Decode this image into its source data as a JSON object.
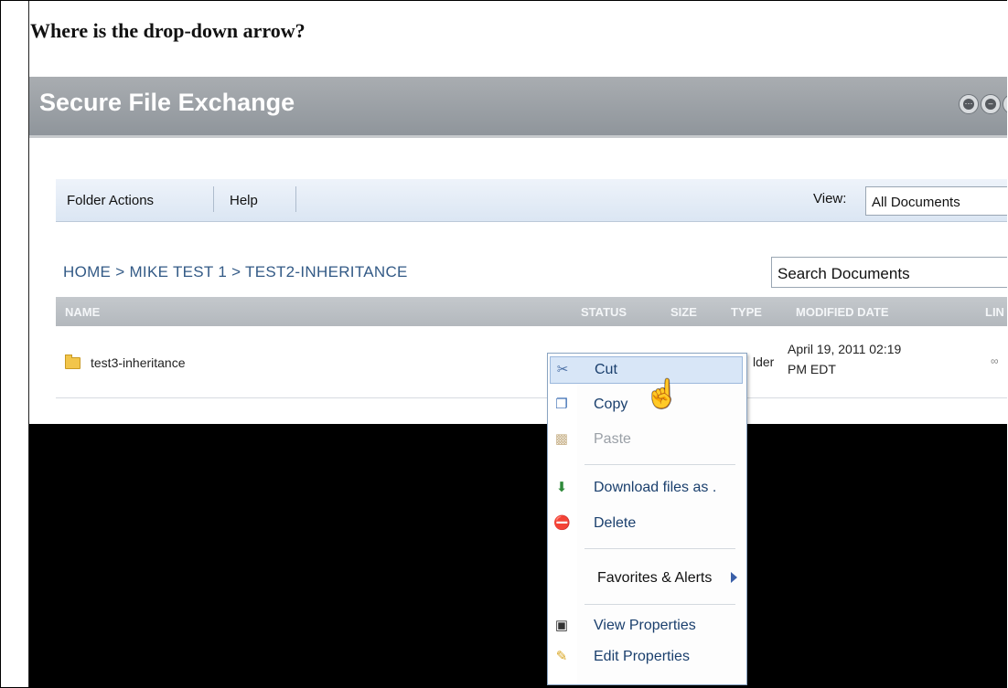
{
  "question": "Where is the drop-down arrow?",
  "app": {
    "title": "Secure File Exchange"
  },
  "toolbar": {
    "folder_actions": "Folder Actions",
    "help": "Help",
    "view_label": "View:",
    "view_value": "All Documents"
  },
  "breadcrumb": "HOME  >  MIKE TEST 1  >  TEST2-INHERITANCE",
  "search": {
    "value": "Search Documents"
  },
  "columns": {
    "name": "NAME",
    "status": "STATUS",
    "size": "SIZE",
    "type": "TYPE",
    "modified": "MODIFIED DATE",
    "link": "LIN"
  },
  "row": {
    "name": "test3-inheritance",
    "type": "lder",
    "modified_line1": "April 19, 2011 02:19",
    "modified_line2": "PM EDT",
    "link": "∞"
  },
  "context_menu": {
    "cut": "Cut",
    "copy": "Copy",
    "paste": "Paste",
    "download": "Download files as .",
    "delete": "Delete",
    "favorites": "Favorites & Alerts",
    "view_properties": "View Properties",
    "edit_properties": "Edit Properties"
  },
  "colors": {
    "header_bg": "#9ca1a6",
    "toolbar_bg": "#e3ebf5",
    "menu_highlight": "#d8e6f7",
    "link_text": "#335a86"
  },
  "icons": [
    "scissors-icon",
    "copy-icon",
    "paste-icon",
    "download-icon",
    "delete-icon",
    "view-properties-icon",
    "edit-properties-icon",
    "folder-icon",
    "hand-cursor-icon"
  ]
}
